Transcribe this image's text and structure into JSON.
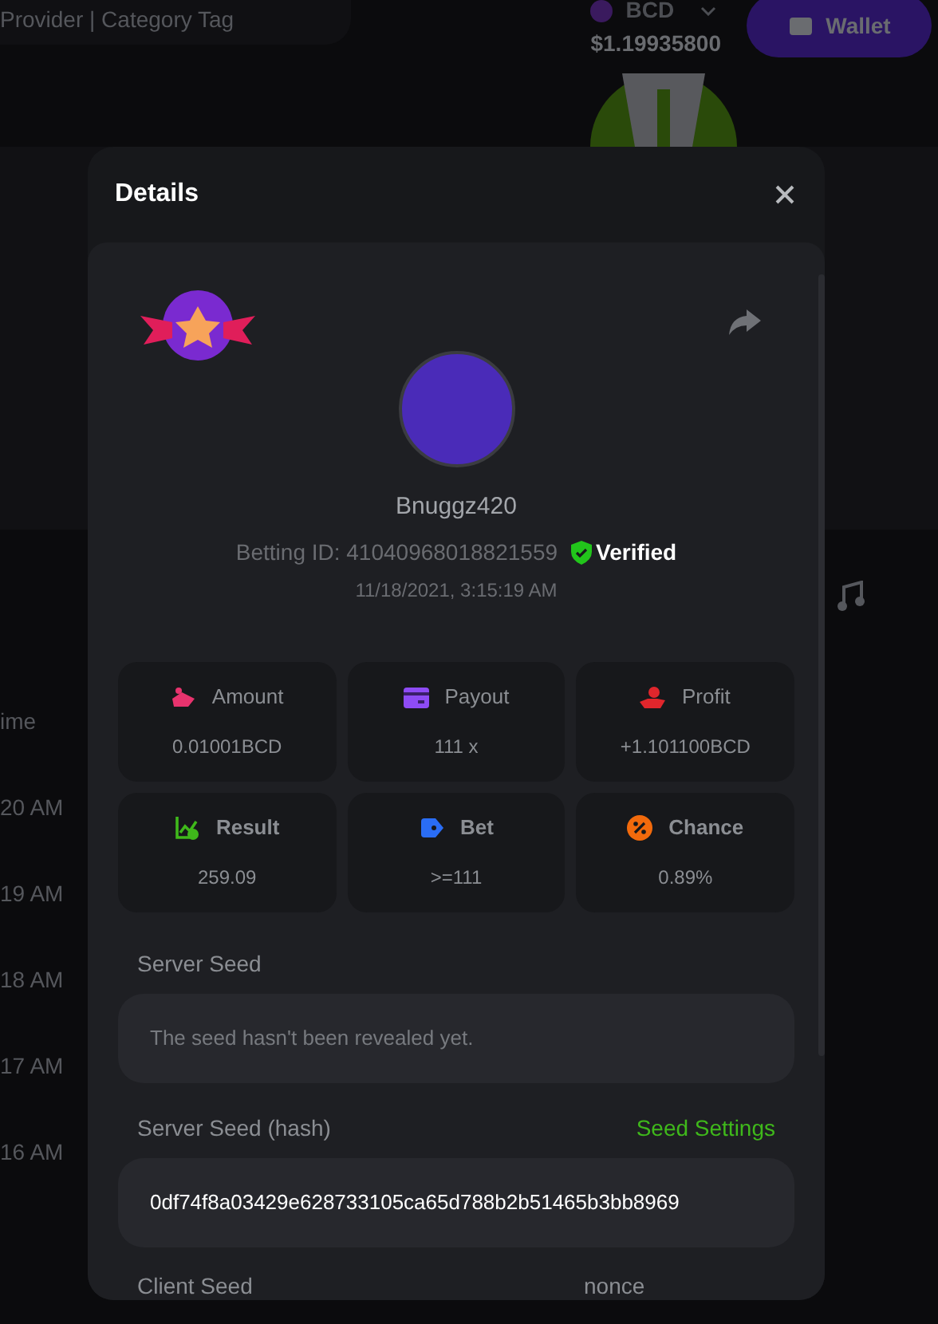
{
  "background": {
    "search_text": "Provider | Category Tag",
    "currency": "BCD",
    "balance": "$1.19935800",
    "wallet_button": "Wallet",
    "column_header": "ime",
    "times": [
      "20 AM",
      "19 AM",
      "18 AM",
      "17 AM",
      "16 AM"
    ]
  },
  "modal": {
    "title": "Details",
    "username": "Bnuggz420",
    "betting_id": "Betting ID: 41040968018821559",
    "verified": true,
    "verified_label": "Verified",
    "date": "11/18/2021, 3:15:19 AM",
    "stats": [
      {
        "kind": "amount",
        "label": "Amount",
        "value": "0.01001BCD"
      },
      {
        "kind": "payout",
        "label": "Payout",
        "value": "111 x"
      },
      {
        "kind": "profit",
        "label": "Profit",
        "value": "+1.101100BCD"
      },
      {
        "kind": "result",
        "label": "Result",
        "value": "259.09"
      },
      {
        "kind": "bet",
        "label": "Bet",
        "value": ">=111"
      },
      {
        "kind": "chance",
        "label": "Chance",
        "value": "0.89%"
      }
    ],
    "server_seed": {
      "label": "Server Seed",
      "placeholder": "The seed hasn't been revealed yet."
    },
    "server_seed_hash": {
      "label": "Server Seed (hash)",
      "link": "Seed Settings",
      "value": "0df74f8a03429e628733105ca65d788b2b51465b3bb8969"
    },
    "client_seed": {
      "label": "Client Seed"
    },
    "nonce": {
      "label": "nonce"
    }
  }
}
